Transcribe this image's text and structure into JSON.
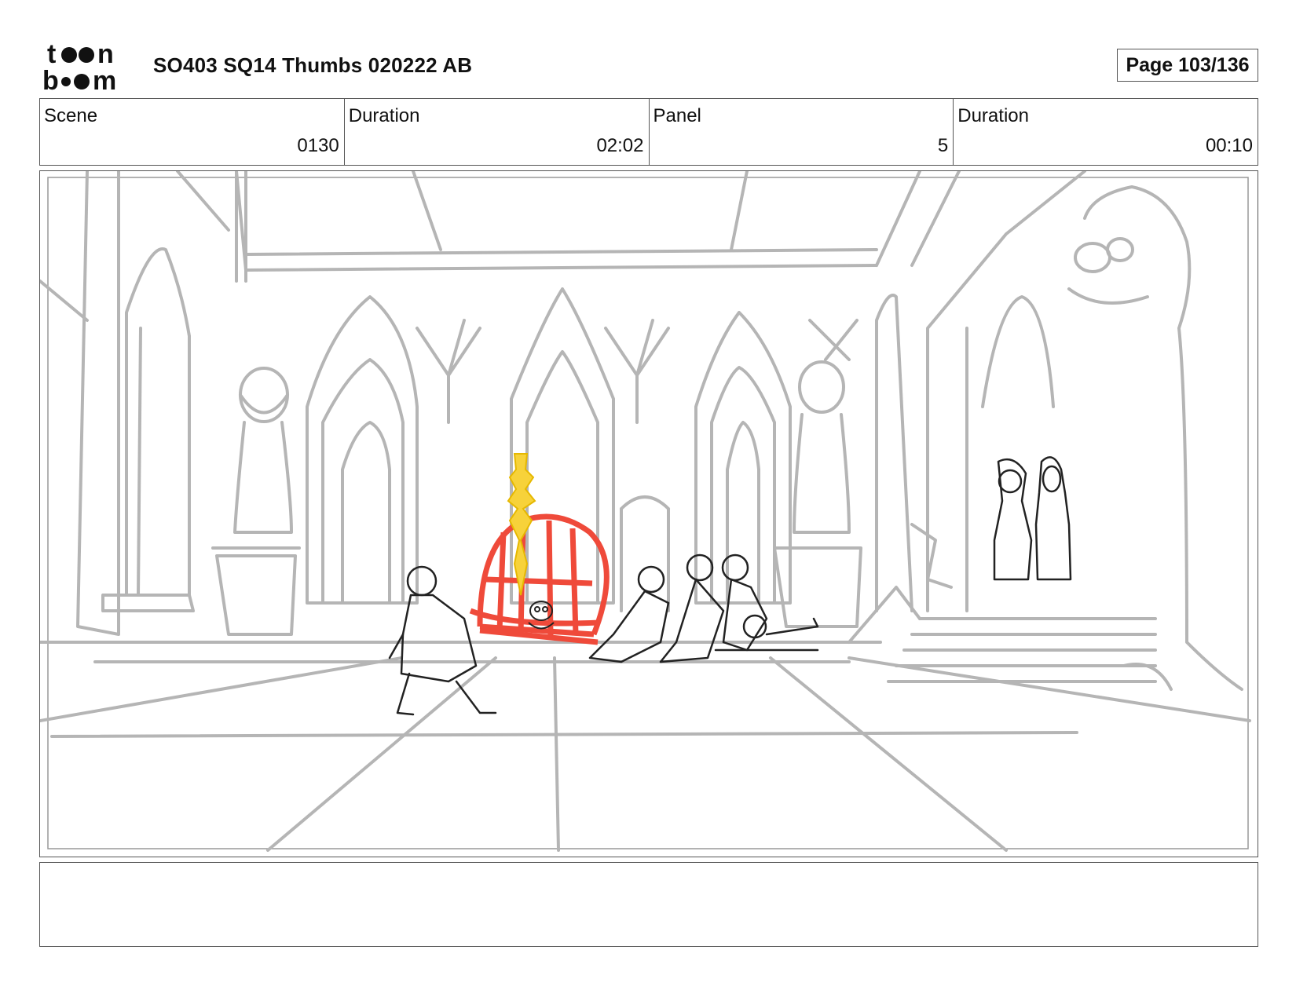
{
  "header": {
    "logo_text": "toon boom",
    "title": "SO403 SQ14 Thumbs 020222 AB",
    "page": "Page 103/136"
  },
  "info": [
    {
      "label": "Scene",
      "value": "0130"
    },
    {
      "label": "Duration",
      "value": "02:02"
    },
    {
      "label": "Panel",
      "value": "5"
    },
    {
      "label": "Duration",
      "value": "00:10"
    }
  ],
  "panel": {
    "colors": {
      "background_lines": "#b5b5b5",
      "character_lines": "#222222",
      "cage": "#ef4a3a",
      "flame": "#f7d23a"
    }
  },
  "notes": {
    "text": ""
  }
}
